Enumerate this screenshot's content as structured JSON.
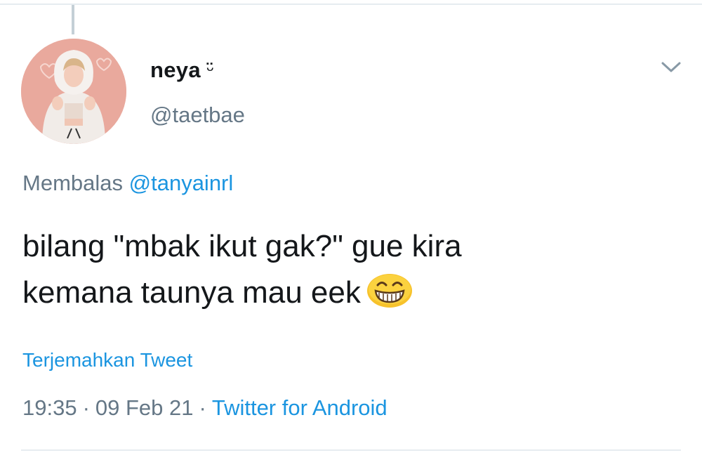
{
  "tweet": {
    "display_name": "neya",
    "name_emoticon": "ᵕ̈",
    "handle": "@taetbae",
    "reply_prefix": "Membalas",
    "reply_mention": "@tanyainrl",
    "text_line1": "bilang \"mbak ikut gak?\" gue kira",
    "text_line2": "kemana taunya mau eek",
    "emoji": "grinning-face-with-smiling-eyes",
    "translate_label": "Terjemahkan Tweet",
    "time": "19:35",
    "date": "09 Feb 21",
    "separator": "·",
    "source": "Twitter for Android"
  },
  "colors": {
    "primary_text": "#14171a",
    "secondary_text": "#657786",
    "link": "#1b95e0",
    "divider": "#e6ecf0",
    "avatar_bg": "#e9a99d"
  },
  "icons": {
    "menu": "chevron-down-icon"
  }
}
